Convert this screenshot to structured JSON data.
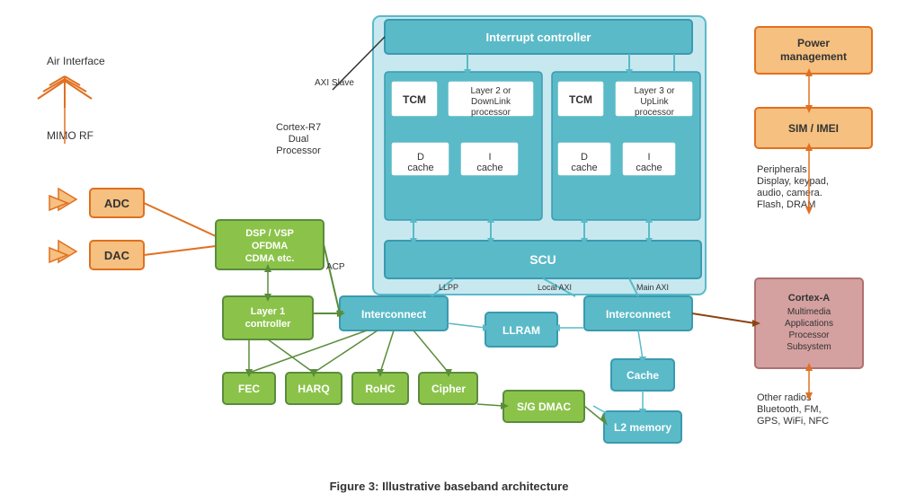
{
  "title": "Figure 3: Illustrative baseband architecture",
  "colors": {
    "teal_dark": "#4a9da8",
    "teal_light": "#7ac5cc",
    "teal_bg": "#d0ecf0",
    "green_dark": "#5a8c3c",
    "green_medium": "#7ab648",
    "green_light": "#b5d98a",
    "orange": "#e07020",
    "orange_light": "#f0a060",
    "brown": "#b07070",
    "brown_light": "#d4a0a0"
  },
  "blocks": {
    "interrupt_controller": "Interrupt controller",
    "tcm1": "TCM",
    "tcm2": "TCM",
    "layer2": "Layer 2 or DownLink processor",
    "layer3": "Layer 3 or UpLink processor",
    "dcache1": "D cache",
    "icache1": "I cache",
    "dcache2": "D cache",
    "icache2": "I cache",
    "scu": "SCU",
    "dsp": "DSP / VSP OFDMA CDMA etc.",
    "cortex_r7": "Cortex-R7 Dual Processor",
    "layer1": "Layer 1 controller",
    "fec": "FEC",
    "harq": "HARQ",
    "rohc": "RoHC",
    "cipher": "Cipher",
    "interconnect1": "Interconnect",
    "interconnect2": "Interconnect",
    "llram": "LLRAM",
    "sg_dmac": "S/G DMAC",
    "cache": "Cache",
    "l2memory": "L2 memory",
    "cortex_a": "Cortex-A Multimedia Applications Processor Subsystem",
    "power_mgmt": "Power management",
    "sim_imei": "SIM / IMEI",
    "peripherals": "Peripherals Display, keypad, audio, camera. Flash, DRAM",
    "other_radios": "Other radios Bluetooth, FM, GPS, WiFi, NFC",
    "adc": "ADC",
    "dac": "DAC",
    "mimo_rf": "MIMO RF",
    "air_interface": "Air Interface"
  },
  "labels": {
    "axi_slave": "AXI Slave",
    "acp": "ACP",
    "llpp": "LLPP",
    "local_axi": "Local AXI",
    "main_axi": "Main AXI"
  }
}
